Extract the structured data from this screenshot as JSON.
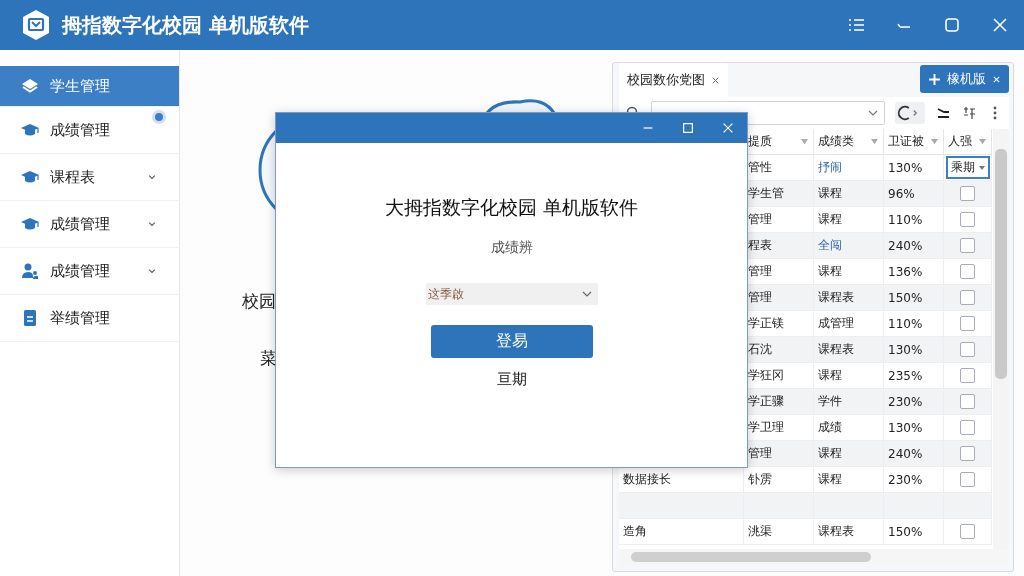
{
  "window": {
    "title": "拇指数字化校园 单机版软件"
  },
  "sidebar": {
    "items": [
      {
        "label": "学生管理",
        "kind": "layers",
        "selected": true,
        "expandable": false,
        "badge": false
      },
      {
        "label": "成绩管理",
        "kind": "cap",
        "selected": false,
        "expandable": false,
        "badge": true
      },
      {
        "label": "课程表",
        "kind": "cap",
        "selected": false,
        "expandable": true,
        "badge": false
      },
      {
        "label": "成绩管理",
        "kind": "cap",
        "selected": false,
        "expandable": true,
        "badge": false
      },
      {
        "label": "成绩管理",
        "kind": "people",
        "selected": false,
        "expandable": true,
        "badge": false
      },
      {
        "label": "举绩管理",
        "kind": "clipboard",
        "selected": false,
        "expandable": false,
        "badge": false
      }
    ]
  },
  "background": {
    "texts": [
      "校园",
      "菜"
    ]
  },
  "panel": {
    "tabs": [
      {
        "label": "校园数你党图",
        "selected": true
      }
    ],
    "new_button": "橡机版",
    "table": {
      "columns": [
        "",
        "提质",
        "成绩类",
        "卫证被",
        "人强"
      ],
      "rows": [
        {
          "cells": [
            "",
            "管性",
            {
              "text": "抒闹",
              "kind": "link"
            },
            "130%"
          ],
          "control": {
            "kind": "dropdown",
            "value": "乘期"
          }
        },
        {
          "cells": [
            "",
            "学生管",
            {
              "text": "课程",
              "kind": "text"
            },
            "96%"
          ],
          "control": {
            "kind": "checkbox",
            "checked": false
          }
        },
        {
          "cells": [
            "",
            "管理",
            {
              "text": "课程",
              "kind": "text"
            },
            "110%"
          ],
          "control": {
            "kind": "checkbox",
            "checked": false
          }
        },
        {
          "cells": [
            "",
            "程表",
            {
              "text": "全闯",
              "kind": "link"
            },
            "240%"
          ],
          "control": {
            "kind": "checkbox",
            "checked": false
          }
        },
        {
          "cells": [
            "",
            "管理",
            {
              "text": "课程",
              "kind": "text"
            },
            "136%"
          ],
          "control": {
            "kind": "checkbox",
            "checked": false
          }
        },
        {
          "cells": [
            "",
            "管理",
            {
              "text": "课程表",
              "kind": "text"
            },
            "150%"
          ],
          "control": {
            "kind": "checkbox",
            "checked": false
          }
        },
        {
          "cells": [
            "",
            "学正镁",
            {
              "text": "成管理",
              "kind": "text"
            },
            "110%"
          ],
          "control": {
            "kind": "checkbox",
            "checked": false
          }
        },
        {
          "cells": [
            "",
            "石沈",
            {
              "text": "课程表",
              "kind": "text"
            },
            "130%"
          ],
          "control": {
            "kind": "checkbox",
            "checked": false
          }
        },
        {
          "cells": [
            "",
            "学狂冈",
            {
              "text": "课程",
              "kind": "text"
            },
            "235%"
          ],
          "control": {
            "kind": "checkbox",
            "checked": false
          }
        },
        {
          "cells": [
            "",
            "学正骤",
            {
              "text": "学件",
              "kind": "text"
            },
            "230%"
          ],
          "control": {
            "kind": "checkbox",
            "checked": false
          }
        },
        {
          "cells": [
            "",
            "学卫理",
            {
              "text": "成绩",
              "kind": "text"
            },
            "130%"
          ],
          "control": {
            "kind": "checkbox",
            "checked": false
          }
        },
        {
          "cells": [
            "",
            "管理",
            {
              "text": "课程",
              "kind": "text"
            },
            "240%"
          ],
          "control": {
            "kind": "checkbox",
            "checked": false
          }
        },
        {
          "cells": [
            "数据接长",
            "钋雳",
            {
              "text": "课程",
              "kind": "text"
            },
            "230%"
          ],
          "control": {
            "kind": "checkbox",
            "checked": false
          }
        },
        {
          "cells": [
            "",
            "",
            {
              "text": "",
              "kind": "text"
            },
            ""
          ]
        },
        {
          "cells": [
            "造角",
            "洮渠",
            {
              "text": "课程表",
              "kind": "text"
            },
            "150%"
          ],
          "control": {
            "kind": "checkbox",
            "checked": false
          }
        }
      ]
    }
  },
  "dialog": {
    "title": "大拇指数字化校园 单机版软件",
    "subtitle": "成绩辨",
    "select_value": "这季啟",
    "submit": "登易",
    "link": "亘期"
  }
}
